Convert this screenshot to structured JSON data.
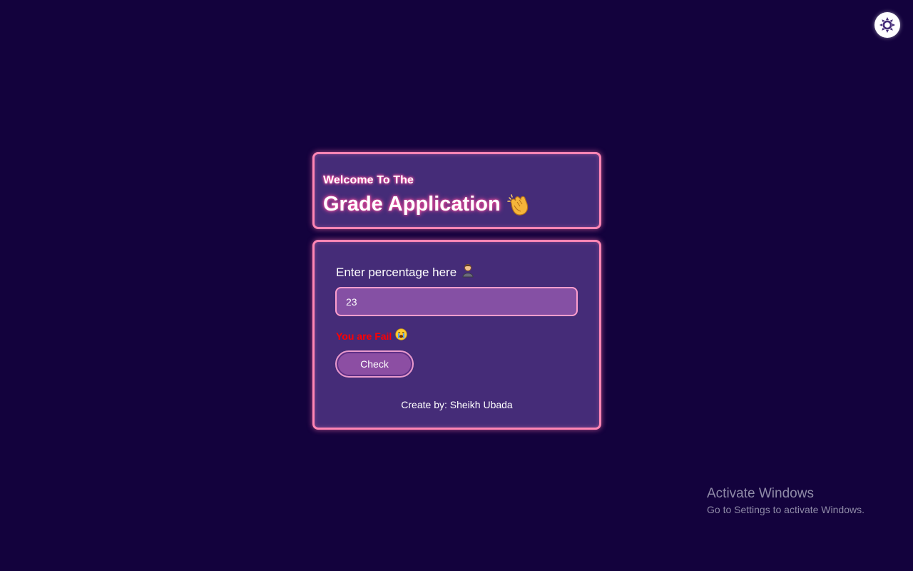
{
  "theme_toggle": {
    "icon": "sun-gear-icon",
    "color": "#452c78"
  },
  "header": {
    "welcome": "Welcome To The",
    "title": "Grade Application",
    "title_icon": "clapping-hands-icon"
  },
  "form": {
    "label": "Enter percentage here",
    "label_icon": "person-icon",
    "input_value": "23",
    "result_text": "You are Fail",
    "result_icon": "crying-face-icon",
    "result_color": "#ff0000",
    "check_label": "Check",
    "credit": "Create by: Sheikh Ubada"
  },
  "watermark": {
    "title": "Activate Windows",
    "subtitle": "Go to Settings to activate Windows."
  },
  "colors": {
    "background": "#13023d",
    "card": "#452c78",
    "card_border": "#ff85b4",
    "input": "#8550a4"
  }
}
